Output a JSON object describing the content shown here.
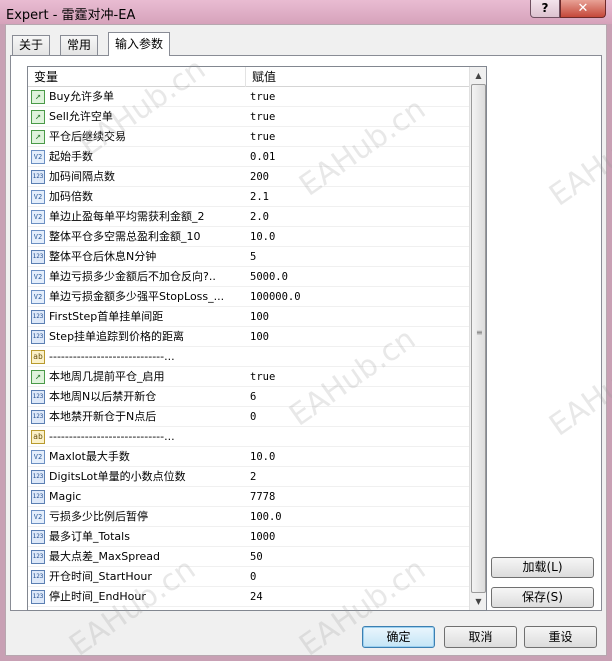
{
  "window": {
    "title": "Expert - 雷霆对冲-EA",
    "help_label": "?",
    "close_label": "✕"
  },
  "tabs": [
    {
      "label": "关于"
    },
    {
      "label": "常用"
    },
    {
      "label": "输入参数"
    }
  ],
  "grid": {
    "header_variable": "变量",
    "header_value": "赋值",
    "scroll_up": "▲",
    "scroll_down": "▼",
    "rows": [
      {
        "type": "bool",
        "icon_text": "↗",
        "name": "Buy允许多单",
        "value": "true"
      },
      {
        "type": "bool",
        "icon_text": "↗",
        "name": "Sell允许空单",
        "value": "true"
      },
      {
        "type": "bool",
        "icon_text": "↗",
        "name": "平仓后继续交易",
        "value": "true"
      },
      {
        "type": "dbl",
        "icon_text": "V2",
        "name": "起始手数",
        "value": "0.01"
      },
      {
        "type": "int",
        "icon_text": "123",
        "name": "加码间隔点数",
        "value": "200"
      },
      {
        "type": "dbl",
        "icon_text": "V2",
        "name": "加码倍数",
        "value": "2.1"
      },
      {
        "type": "dbl",
        "icon_text": "V2",
        "name": "单边止盈每单平均需获利金额_2",
        "value": "2.0"
      },
      {
        "type": "dbl",
        "icon_text": "V2",
        "name": "整体平仓多空需总盈利金额_10",
        "value": "10.0"
      },
      {
        "type": "int",
        "icon_text": "123",
        "name": "整体平仓后休息N分钟",
        "value": "5"
      },
      {
        "type": "dbl",
        "icon_text": "V2",
        "name": "单边亏损多少金额后不加仓反向?..",
        "value": "5000.0"
      },
      {
        "type": "dbl",
        "icon_text": "V2",
        "name": "单边亏损金额多少强平StopLoss_...",
        "value": "100000.0"
      },
      {
        "type": "int",
        "icon_text": "123",
        "name": "FirstStep首单挂单间距",
        "value": "100"
      },
      {
        "type": "int",
        "icon_text": "123",
        "name": "Step挂单追踪到价格的距离",
        "value": "100"
      },
      {
        "type": "str",
        "icon_text": "ab",
        "name": "-----------------------------...",
        "value": ""
      },
      {
        "type": "bool",
        "icon_text": "↗",
        "name": "本地周几提前平仓_启用",
        "value": "true"
      },
      {
        "type": "int",
        "icon_text": "123",
        "name": "本地周N以后禁开新仓",
        "value": "6"
      },
      {
        "type": "int",
        "icon_text": "123",
        "name": "本地禁开新仓于N点后",
        "value": "0"
      },
      {
        "type": "str",
        "icon_text": "ab",
        "name": "-----------------------------...",
        "value": ""
      },
      {
        "type": "dbl",
        "icon_text": "V2",
        "name": "Maxlot最大手数",
        "value": "10.0"
      },
      {
        "type": "int",
        "icon_text": "123",
        "name": "DigitsLot单量的小数点位数",
        "value": "2"
      },
      {
        "type": "int",
        "icon_text": "123",
        "name": "Magic",
        "value": "7778"
      },
      {
        "type": "dbl",
        "icon_text": "V2",
        "name": "亏损多少比例后暂停",
        "value": "100.0"
      },
      {
        "type": "int",
        "icon_text": "123",
        "name": "最多订单_Totals",
        "value": "1000"
      },
      {
        "type": "int",
        "icon_text": "123",
        "name": "最大点差_MaxSpread",
        "value": "50"
      },
      {
        "type": "int",
        "icon_text": "123",
        "name": "开仓时间_StartHour",
        "value": "0"
      },
      {
        "type": "int",
        "icon_text": "123",
        "name": "停止时间_EndHour",
        "value": "24"
      }
    ]
  },
  "side_buttons": {
    "load": "加载(L)",
    "save": "保存(S)"
  },
  "bottom_buttons": {
    "ok": "确定",
    "cancel": "取消",
    "reset": "重设"
  },
  "watermark": "EAHub.cn"
}
